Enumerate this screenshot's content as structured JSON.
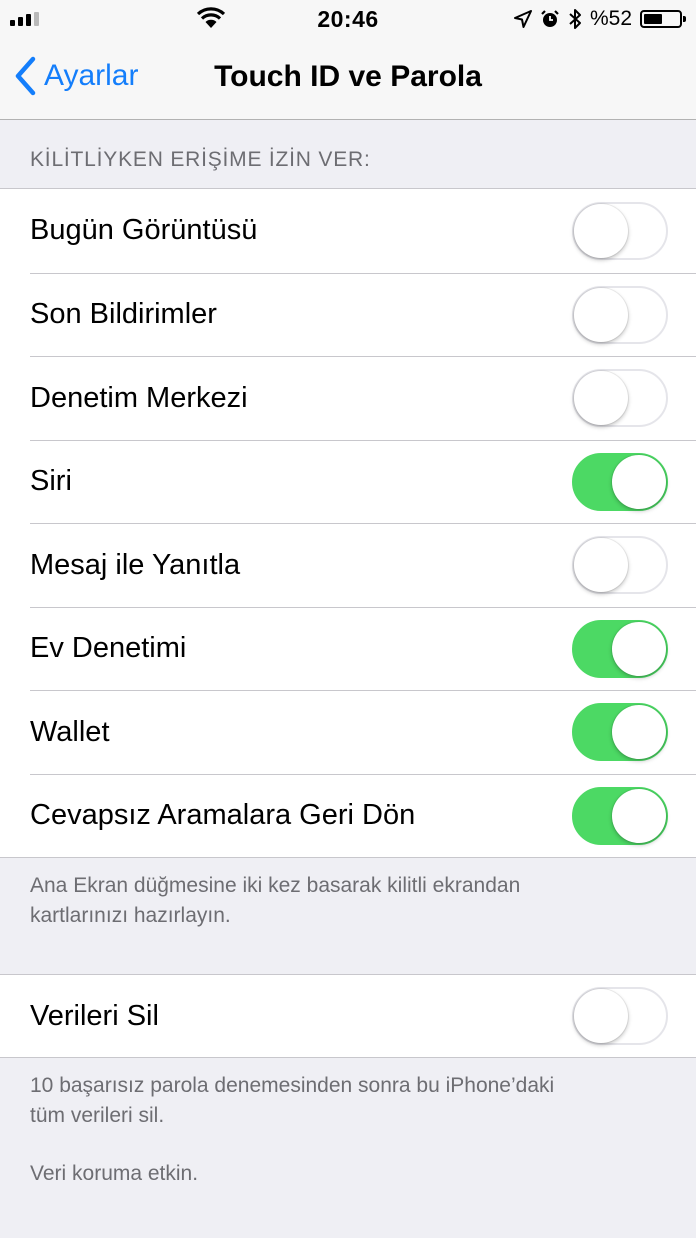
{
  "status_bar": {
    "time": "20:46",
    "battery_percent": "%52",
    "battery_level": 0.52,
    "signal_bars_filled": 3,
    "signal_bars_total": 5,
    "icons": [
      "signal-icon",
      "wifi-icon",
      "location-arrow-icon",
      "alarm-icon",
      "bluetooth-icon",
      "battery-icon"
    ]
  },
  "nav": {
    "back_label": "Ayarlar",
    "title": "Touch ID ve Parola"
  },
  "section": {
    "header": "KİLİTLİYKEN ERİŞİME İZİN VER:",
    "items": [
      {
        "label": "Bugün Görüntüsü",
        "on": false
      },
      {
        "label": "Son Bildirimler",
        "on": false
      },
      {
        "label": "Denetim Merkezi",
        "on": false
      },
      {
        "label": "Siri",
        "on": true
      },
      {
        "label": "Mesaj ile Yanıtla",
        "on": false
      },
      {
        "label": "Ev Denetimi",
        "on": true
      },
      {
        "label": "Wallet",
        "on": true
      },
      {
        "label": "Cevapsız Aramalara Geri Dön",
        "on": true
      }
    ],
    "footer_line1": "Ana Ekran düğmesine iki kez basarak kilitli ekrandan",
    "footer_line2": "kartlarınızı hazırlayın."
  },
  "erase": {
    "label": "Verileri Sil",
    "on": false,
    "footer_line1": "10 başarısız parola denemesinden sonra bu iPhone’daki",
    "footer_line2": "tüm verileri sil.",
    "footer_note": "Veri koruma etkin."
  },
  "colors": {
    "accent": "#147efb",
    "toggle_on": "#4cd964",
    "background": "#efeff4"
  }
}
